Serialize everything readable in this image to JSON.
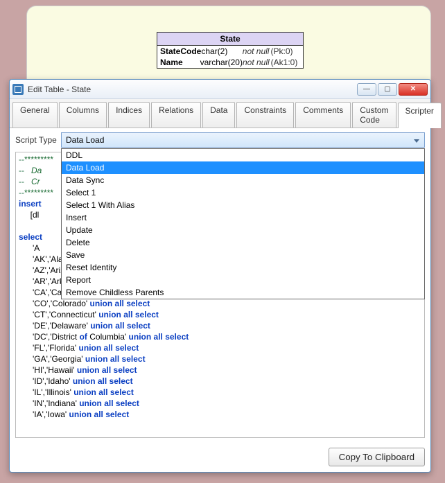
{
  "schema": {
    "title": "State",
    "rows": [
      {
        "name": "StateCode",
        "type": "char(2)",
        "nullness": "not null",
        "key": "(Pk:0)"
      },
      {
        "name": "Name",
        "type": "varchar(20)",
        "nullness": "not null",
        "key": "(Ak1:0)"
      }
    ]
  },
  "window": {
    "title": "Edit Table - State",
    "tabs": [
      "General",
      "Columns",
      "Indices",
      "Relations",
      "Data",
      "Constraints",
      "Comments",
      "Custom Code",
      "Scripter"
    ],
    "active_tab": "Scripter"
  },
  "scripttype": {
    "label": "Script Type",
    "selected": "Data Load",
    "options": [
      "DDL",
      "Data Load",
      "Data Sync",
      "Select 1",
      "Select 1 With Alias",
      "Insert",
      "Update",
      "Delete",
      "Save",
      "Reset Identity",
      "Report",
      "Remove Childless Parents"
    ]
  },
  "code": {
    "stars_line": "--*****************************************",
    "comment_line1_prefix": "--   ",
    "comment_line1_kw": "Data",
    "comment_line1_rest": "",
    "comment_line2_prefix": "--   ",
    "comment_line2_text": "Cr",
    "insert_kw": "insert",
    "insert_line": "     [dl",
    "select_kw": "select",
    "union": "union all select",
    "rows": [
      {
        "pair": "'A",
        "rest": ""
      },
      {
        "pair": "'AK','Alaska' ",
        "rest": ""
      },
      {
        "pair": "'AZ','Arizona' ",
        "rest": ""
      },
      {
        "pair": "'AR','Arkansas' ",
        "rest": ""
      },
      {
        "pair": "'CA','California' ",
        "rest": ""
      },
      {
        "pair": "'CO','Colorado' ",
        "rest": ""
      },
      {
        "pair": "'CT','Connecticut' ",
        "rest": ""
      },
      {
        "pair": "'DE','Delaware' ",
        "rest": ""
      },
      {
        "pair": "'DC','District ",
        "rest_of": "of Columbia' "
      },
      {
        "pair": "'FL','Florida' ",
        "rest": ""
      },
      {
        "pair": "'GA','Georgia' ",
        "rest": ""
      },
      {
        "pair": "'HI','Hawaii' ",
        "rest": ""
      },
      {
        "pair": "'ID','Idaho' ",
        "rest": ""
      },
      {
        "pair": "'IL','Illinois' ",
        "rest": ""
      },
      {
        "pair": "'IN','Indiana' ",
        "rest": ""
      },
      {
        "pair": "'IA','Iowa' ",
        "rest": ""
      }
    ]
  },
  "buttons": {
    "copy": "Copy To Clipboard"
  }
}
